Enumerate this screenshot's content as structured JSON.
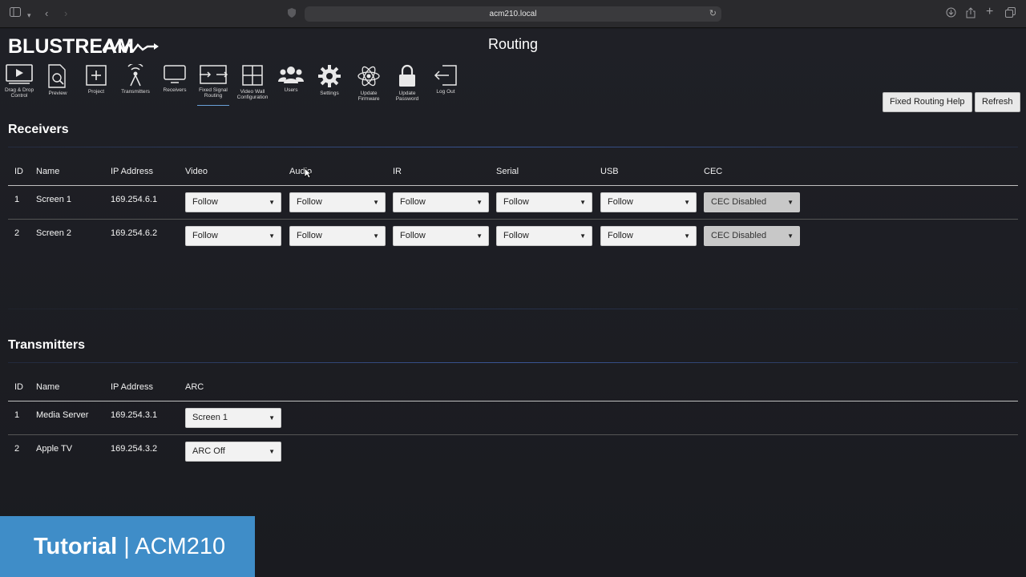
{
  "browser": {
    "url": "acm210.local"
  },
  "app": {
    "logo": "BLUSTREAM",
    "page_title": "Routing"
  },
  "nav": [
    {
      "label": "Drag & Drop Control"
    },
    {
      "label": "Preview"
    },
    {
      "label": "Project"
    },
    {
      "label": "Transmitters"
    },
    {
      "label": "Receivers"
    },
    {
      "label": "Fixed Signal Routing"
    },
    {
      "label": "Video Wall Configuration"
    },
    {
      "label": "Users"
    },
    {
      "label": "Settings"
    },
    {
      "label": "Update Firmware"
    },
    {
      "label": "Update Password"
    },
    {
      "label": "Log Out"
    }
  ],
  "receivers": {
    "title": "Receivers",
    "help_button": "Fixed Routing Help",
    "refresh_button": "Refresh",
    "columns": [
      "ID",
      "Name",
      "IP Address",
      "Video",
      "Audio",
      "IR",
      "Serial",
      "USB",
      "CEC"
    ],
    "rows": [
      {
        "id": "1",
        "name": "Screen 1",
        "ip": "169.254.6.1",
        "video": "Follow",
        "audio": "Follow",
        "ir": "Follow",
        "serial": "Follow",
        "usb": "Follow",
        "cec": "CEC Disabled"
      },
      {
        "id": "2",
        "name": "Screen 2",
        "ip": "169.254.6.2",
        "video": "Follow",
        "audio": "Follow",
        "ir": "Follow",
        "serial": "Follow",
        "usb": "Follow",
        "cec": "CEC Disabled"
      }
    ]
  },
  "transmitters": {
    "title": "Transmitters",
    "columns": [
      "ID",
      "Name",
      "IP Address",
      "ARC"
    ],
    "rows": [
      {
        "id": "1",
        "name": "Media Server",
        "ip": "169.254.3.1",
        "arc": "Screen 1"
      },
      {
        "id": "2",
        "name": "Apple TV",
        "ip": "169.254.3.2",
        "arc": "ARC Off"
      }
    ]
  },
  "banner": {
    "brand": "Tutorial",
    "separator": " | ",
    "product": "ACM210"
  },
  "colors": {
    "accent": "#3f8dc8",
    "background": "#1b1c21"
  }
}
